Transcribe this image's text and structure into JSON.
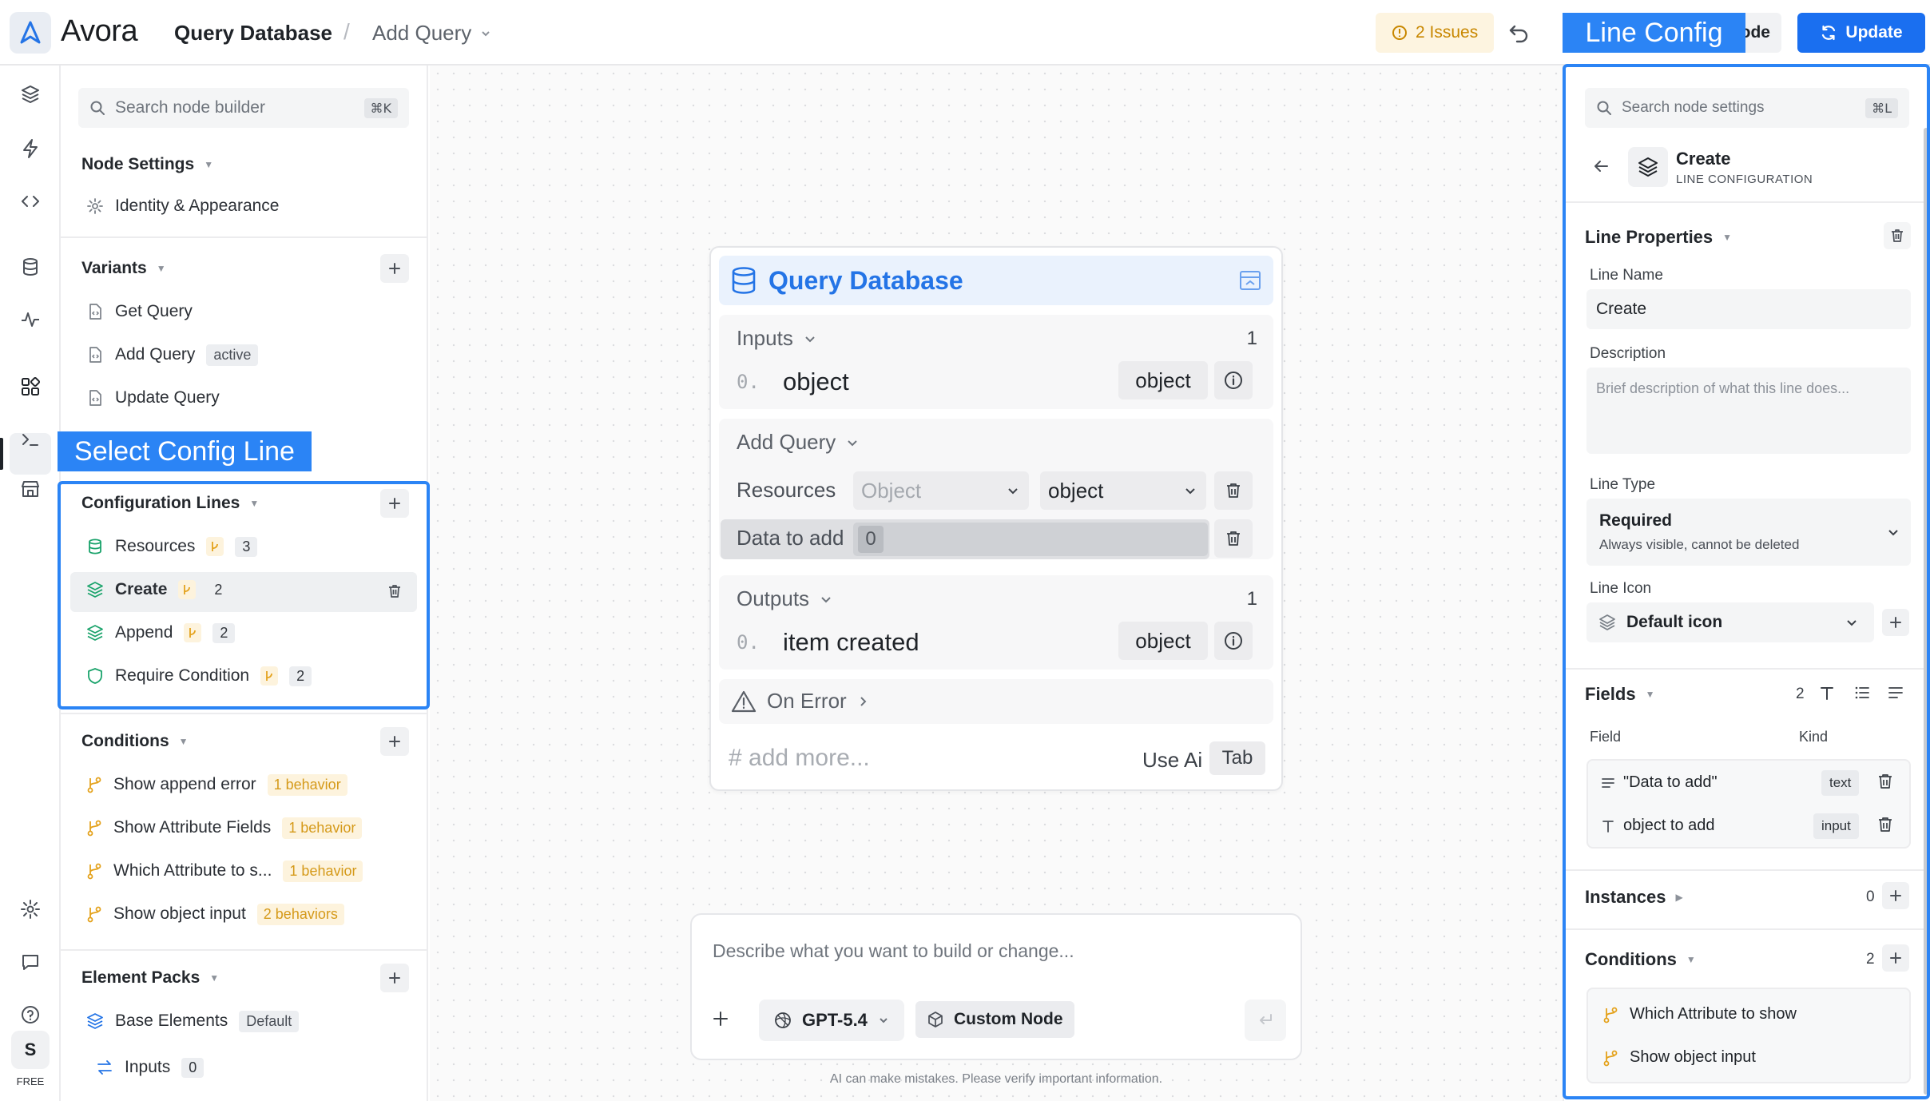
{
  "topbar": {
    "brand": "Avora",
    "breadcrumb_node": "Query Database",
    "breadcrumb_sep": "/",
    "breadcrumb_variant": "Add Query",
    "issues_label": "2 Issues",
    "mode_label": "ode",
    "update_label": "Update"
  },
  "annotations": {
    "line_config": "Line Config",
    "select_config_line": "Select Config Line"
  },
  "rail": {
    "plan_label": "FREE",
    "avatar_initial": "S"
  },
  "left": {
    "search_placeholder": "Search node builder",
    "search_shortcut": "⌘K",
    "node_settings": {
      "title": "Node Settings",
      "items": [
        {
          "label": "Identity & Appearance",
          "icon": "gear-icon"
        }
      ]
    },
    "variants": {
      "title": "Variants",
      "items": [
        {
          "label": "Get Query",
          "badge": ""
        },
        {
          "label": "Add Query",
          "badge": "active"
        },
        {
          "label": "Update Query",
          "badge": ""
        }
      ]
    },
    "config_lines": {
      "title": "Configuration Lines",
      "items": [
        {
          "label": "Resources",
          "count": "3",
          "icon": "database-icon",
          "selected": false
        },
        {
          "label": "Create",
          "count": "2",
          "icon": "layers-icon",
          "selected": true
        },
        {
          "label": "Append",
          "count": "2",
          "icon": "layers-icon",
          "selected": false
        },
        {
          "label": "Require Condition",
          "count": "2",
          "icon": "shield-icon",
          "selected": false
        }
      ]
    },
    "conditions": {
      "title": "Conditions",
      "items": [
        {
          "label": "Show append error",
          "badge": "1 behavior"
        },
        {
          "label": "Show Attribute Fields",
          "badge": "1 behavior"
        },
        {
          "label": "Which Attribute to s...",
          "badge": "1 behavior"
        },
        {
          "label": "Show object input",
          "badge": "2 behaviors"
        }
      ]
    },
    "element_packs": {
      "title": "Element Packs",
      "items": [
        {
          "label": "Base Elements",
          "badge": "Default"
        },
        {
          "label": "Inputs",
          "badge": "0"
        }
      ]
    }
  },
  "node": {
    "title": "Query Database",
    "inputs": {
      "label": "Inputs",
      "count": "1",
      "rows": [
        {
          "index": "0.",
          "name": "object",
          "type": "object"
        }
      ]
    },
    "add_query": {
      "label": "Add Query",
      "resources_label": "Resources",
      "resources_select_1": "Object",
      "resources_select_2": "object",
      "data_label": "Data to add",
      "data_value": "0"
    },
    "outputs": {
      "label": "Outputs",
      "count": "1",
      "rows": [
        {
          "index": "0.",
          "name": "item created",
          "type": "object"
        }
      ]
    },
    "on_error": "On Error",
    "add_more": "# add more...",
    "use_ai": "Use Ai",
    "tab_key": "Tab"
  },
  "prompt": {
    "placeholder": "Describe what you want to build or change...",
    "model": "GPT-5.4",
    "custom_node": "Custom Node",
    "disclaimer": "AI can make mistakes. Please verify important information."
  },
  "right": {
    "search_placeholder": "Search node settings",
    "search_shortcut": "⌘L",
    "header_title": "Create",
    "header_subtitle": "LINE CONFIGURATION",
    "line_properties": "Line Properties",
    "line_name_label": "Line Name",
    "line_name_value": "Create",
    "description_label": "Description",
    "description_placeholder": "Brief description of what this line does...",
    "line_type_label": "Line Type",
    "line_type_value": "Required",
    "line_type_hint": "Always visible, cannot be deleted",
    "line_icon_label": "Line Icon",
    "line_icon_value": "Default icon",
    "fields_title": "Fields",
    "fields_count": "2",
    "fields_col_field": "Field",
    "fields_col_kind": "Kind",
    "fields": [
      {
        "name": "\"Data to add\"",
        "kind": "text"
      },
      {
        "name": "object to add",
        "kind": "input"
      }
    ],
    "instances_title": "Instances",
    "instances_count": "0",
    "conditions_title": "Conditions",
    "conditions_count": "2",
    "conditions": [
      {
        "label": "Which Attribute to show"
      },
      {
        "label": "Show object input"
      }
    ]
  }
}
